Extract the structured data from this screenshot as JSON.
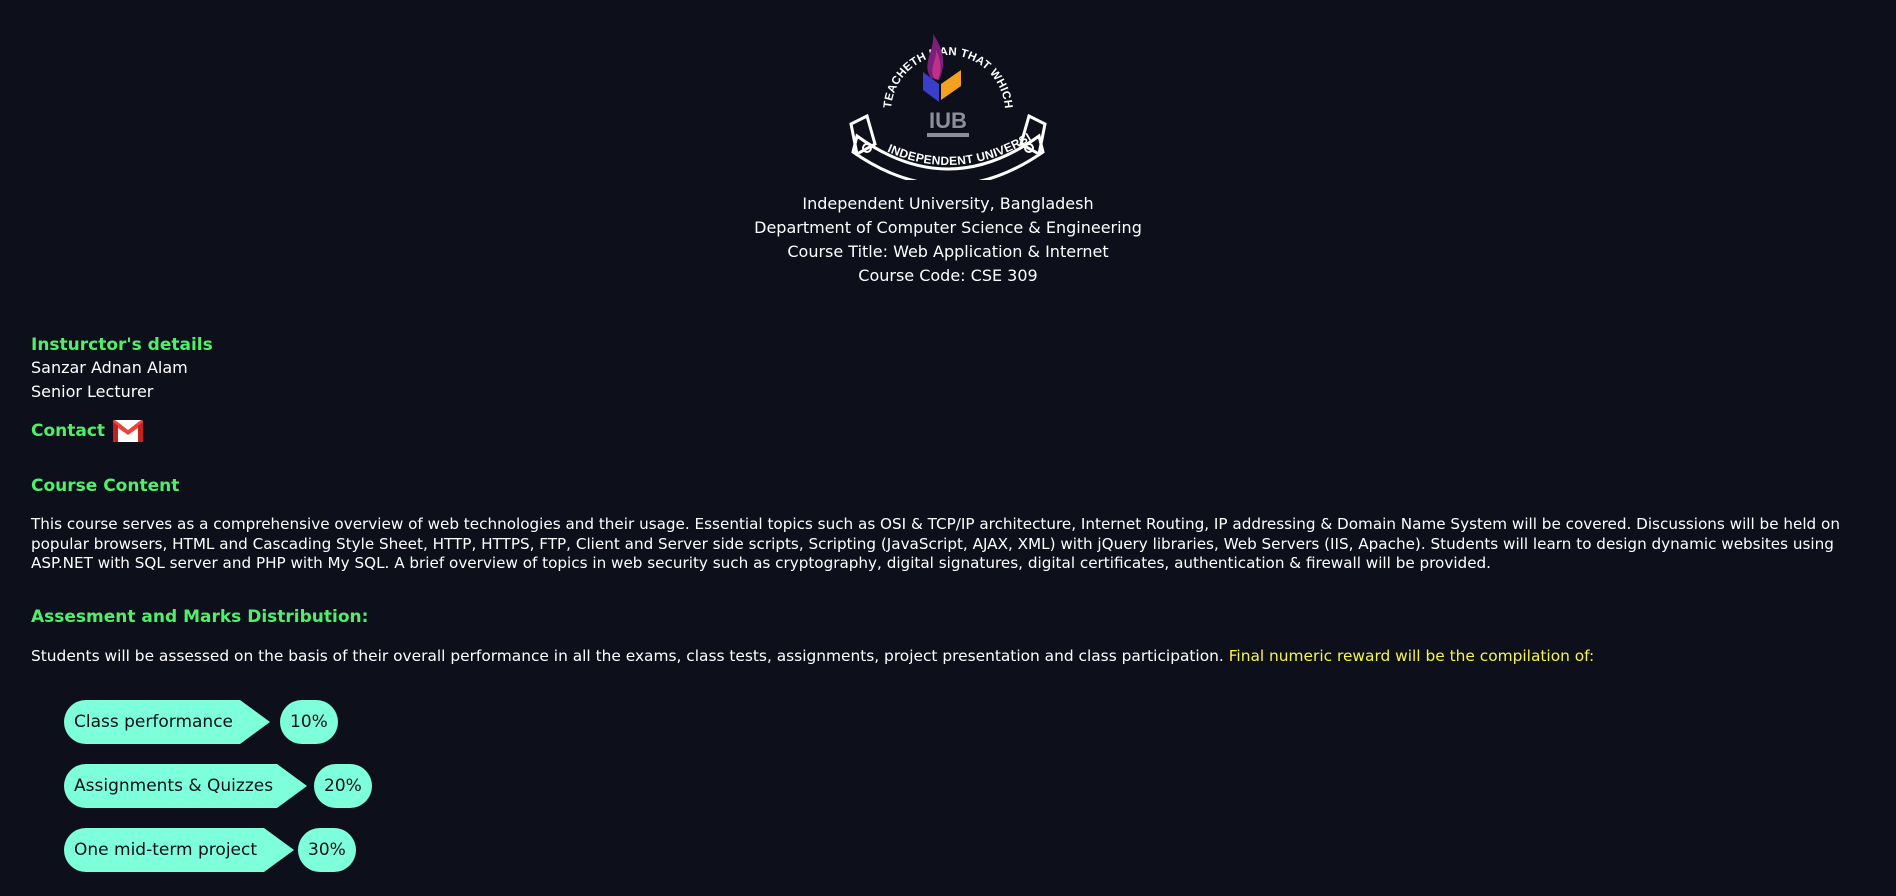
{
  "logo": {
    "motto": "TEACHETH MAN THAT WHICH HE KNEW NOT",
    "banner": "INDEPENDENT UNIVERSITY",
    "abbr": "IUB"
  },
  "header": {
    "university": "Independent University, Bangladesh",
    "department": "Department of Computer Science & Engineering",
    "course_title": "Course Title: Web Application & Internet",
    "course_code": "Course Code: CSE 309"
  },
  "instructor": {
    "heading": "Insturctor's details",
    "name": "Sanzar Adnan Alam",
    "designation": "Senior Lecturer"
  },
  "contact": {
    "heading": "Contact",
    "icon": "gmail-icon"
  },
  "course_content": {
    "heading": "Course Content",
    "text": "This course serves as a comprehensive overview of web technologies and their usage. Essential topics such as OSI & TCP/IP architecture, Internet Routing, IP addressing & Domain Name System will be covered. Discussions will be held on popular browsers, HTML and Cascading Style Sheet, HTTP, HTTPS, FTP, Client and Server side scripts, Scripting (JavaScript, AJAX, XML) with jQuery libraries, Web Servers (IIS, Apache). Students will learn to design dynamic websites using ASP.NET with SQL server and PHP with My SQL. A brief overview of topics in web security such as cryptography, digital signatures, digital certificates, authentication & firewall will be provided."
  },
  "assessment": {
    "heading": "Assesment and Marks Distribution:",
    "text": "Students will be assessed on the basis of their overall performance in all the exams, class tests, assignments, project presentation and class participation.",
    "highlight": "Final numeric reward will be the compilation of:",
    "highlight_color": "#f5f54a",
    "items": [
      {
        "label": "Class performance",
        "percent": "10%"
      },
      {
        "label": "Assignments & Quizzes",
        "percent": "20%"
      },
      {
        "label": "One mid-term project",
        "percent": "30%"
      }
    ]
  },
  "colors": {
    "background": "#0d0f1a",
    "heading": "#4ef06a",
    "pill": "#7dffd9"
  }
}
